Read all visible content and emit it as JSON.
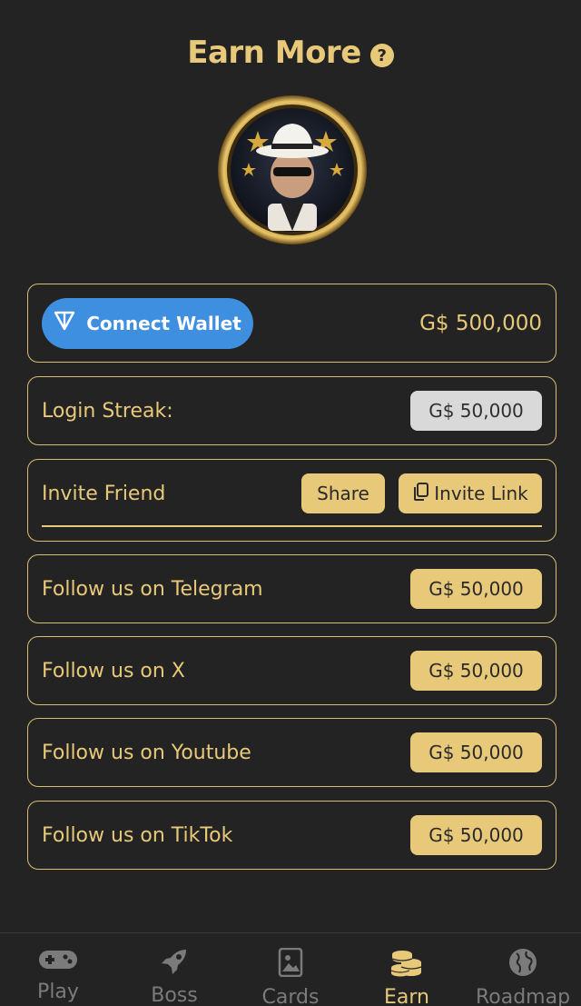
{
  "header": {
    "title": "Earn More",
    "help_glyph": "?"
  },
  "wallet": {
    "button_label": "Connect Wallet",
    "amount": "G$ 500,000",
    "button_color": "#3f8fe0"
  },
  "login_streak": {
    "label": "Login Streak:",
    "reward": "G$ 50,000"
  },
  "invite": {
    "label": "Invite Friend",
    "share_label": "Share",
    "invite_link_label": "Invite Link"
  },
  "tasks": [
    {
      "label": "Follow us on Telegram",
      "reward": "G$ 50,000"
    },
    {
      "label": "Follow us on X",
      "reward": "G$ 50,000"
    },
    {
      "label": "Follow us on Youtube",
      "reward": "G$ 50,000"
    },
    {
      "label": "Follow us on TikTok",
      "reward": "G$ 50,000"
    }
  ],
  "tabs": [
    {
      "label": "Play",
      "icon": "gamepad-icon",
      "active": false
    },
    {
      "label": "Boss",
      "icon": "rocket-icon",
      "active": false
    },
    {
      "label": "Cards",
      "icon": "card-icon",
      "active": false
    },
    {
      "label": "Earn",
      "icon": "coins-icon",
      "active": true
    },
    {
      "label": "Roadmap",
      "icon": "globe-icon",
      "active": false
    }
  ],
  "colors": {
    "accent": "#e8c979",
    "background": "#232323",
    "inactive_tab": "#7b7b7b"
  }
}
